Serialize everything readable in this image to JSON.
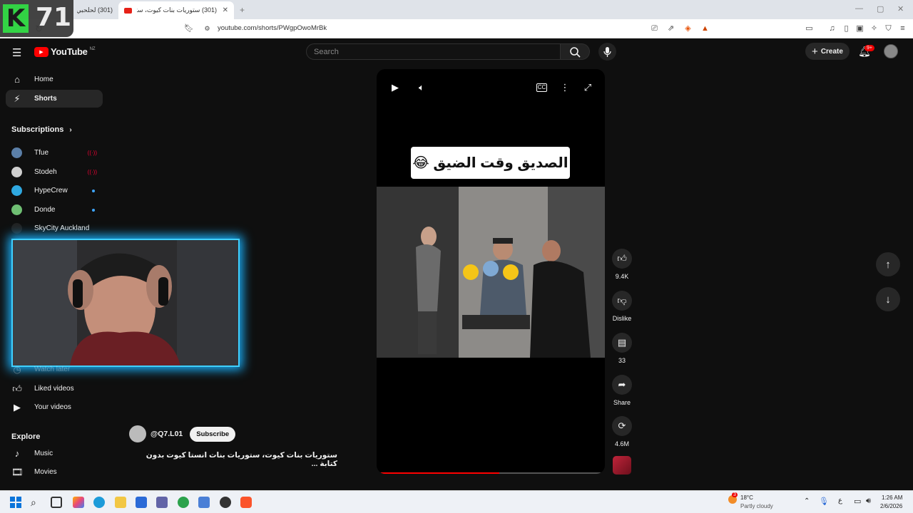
{
  "browser": {
    "tabs": [
      {
        "title": "(301) لحلحبي ولاتحك"
      },
      {
        "title": "(301) ستوريات بنات كيوت، ستو"
      }
    ],
    "url": "youtube.com/shorts/PWgpOwoMrBk",
    "ext_badge": "9+"
  },
  "overlay_logo": {
    "letter": "K",
    "number": "71"
  },
  "header": {
    "logo_text": "YouTube",
    "region": "NZ",
    "search_placeholder": "Search",
    "create_label": "Create",
    "notif_badge": "9+"
  },
  "sidebar": {
    "main": [
      {
        "label": "Home",
        "icon": "home-icon"
      },
      {
        "label": "Shorts",
        "icon": "shorts-icon"
      }
    ],
    "subscriptions_title": "Subscriptions",
    "subscriptions": [
      {
        "name": "Tfue",
        "color": "#5b7fa8",
        "status": "live"
      },
      {
        "name": "Stodeh",
        "color": "#cfcfcf",
        "status": "live"
      },
      {
        "name": "HypeCrew",
        "color": "#2fa8e0",
        "status": "new"
      },
      {
        "name": "Donde",
        "color": "#6fbf73",
        "status": "new"
      },
      {
        "name": "SkyCity Auckland",
        "color": "#222222",
        "status": ""
      }
    ],
    "you": [
      {
        "label": "Watch later",
        "icon": "clock-icon"
      },
      {
        "label": "Liked videos",
        "icon": "thumbs-up-icon"
      },
      {
        "label": "Your videos",
        "icon": "video-icon"
      }
    ],
    "explore_title": "Explore",
    "explore": [
      {
        "label": "Music",
        "icon": "music-icon"
      },
      {
        "label": "Movies",
        "icon": "movies-icon"
      }
    ]
  },
  "short": {
    "caption": "الصديق وقت الضيق 😂",
    "progress": 0.54,
    "channel": "@Q7.L01",
    "subscribe_label": "Subscribe",
    "title": "ستوريات بنات كيوت، ستوريات بنات انستا كيوت بدون كتابة ..."
  },
  "actions": {
    "likes": "9.4K",
    "dislike_label": "Dislike",
    "comments": "33",
    "share_label": "Share",
    "remix": "4.6M"
  },
  "taskbar": {
    "weather_temp": "18°C",
    "weather_desc": "Partly cloudy",
    "weather_badge": "3",
    "lang": "ع",
    "time": "1:26 AM",
    "date": "2/6/2026"
  },
  "colors": {
    "accent": "#ff0000",
    "glow": "#1ab3ff",
    "bg": "#0f0f0f"
  }
}
